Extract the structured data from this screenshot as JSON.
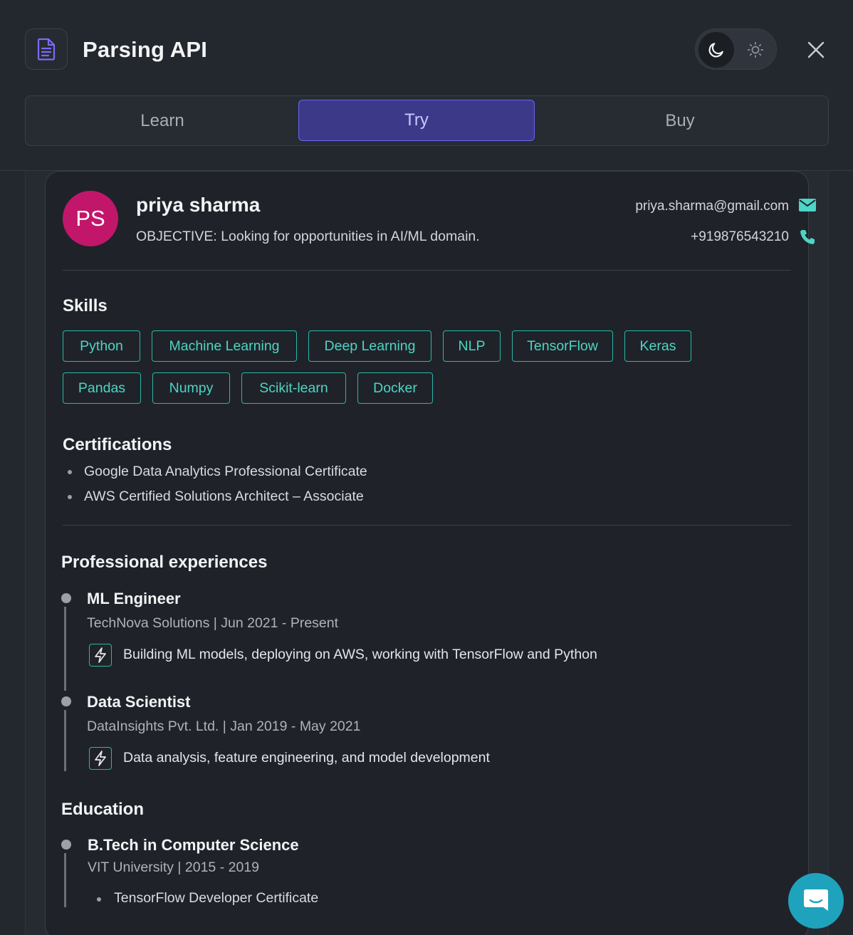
{
  "header": {
    "title": "Parsing API",
    "icons": {
      "app": "document-icon",
      "dark": "moon-icon",
      "light": "sun-icon",
      "close": "close-icon"
    }
  },
  "tabs": [
    {
      "label": "Learn"
    },
    {
      "label": "Try",
      "active": true
    },
    {
      "label": "Buy"
    }
  ],
  "profile": {
    "initials": "PS",
    "name": "priya sharma",
    "objective": "OBJECTIVE: Looking for opportunities in AI/ML domain.",
    "email": "priya.sharma@gmail.com",
    "phone": "+919876543210",
    "avatar_color": "#c2166b"
  },
  "skills": {
    "title": "Skills",
    "items": [
      "Python",
      "Machine Learning",
      "Deep Learning",
      "NLP",
      "TensorFlow",
      "Keras",
      "Pandas",
      "Numpy",
      "Scikit-learn",
      "Docker"
    ]
  },
  "certifications": {
    "title": "Certifications",
    "items": [
      "Google Data Analytics Professional Certificate",
      "AWS Certified Solutions Architect – Associate"
    ]
  },
  "experience": {
    "title": "Professional experiences",
    "items": [
      {
        "title": "ML Engineer",
        "sub": "TechNova Solutions | Jun 2021 - Present",
        "desc": "Building ML models, deploying on AWS, working with TensorFlow and Python"
      },
      {
        "title": "Data Scientist",
        "sub": "DataInsights Pvt. Ltd. | Jan 2019 - May 2021",
        "desc": "Data analysis, feature engineering, and model development"
      }
    ]
  },
  "education": {
    "title": "Education",
    "items": [
      {
        "degree": "B.Tech in Computer Science",
        "sub": "VIT University | 2015 - 2019",
        "notes": [
          "TensorFlow Developer Certificate"
        ]
      }
    ]
  },
  "colors": {
    "accent": "#4dd5c5",
    "tab_active": "#3c3a88",
    "chat": "#1fa3bd"
  }
}
